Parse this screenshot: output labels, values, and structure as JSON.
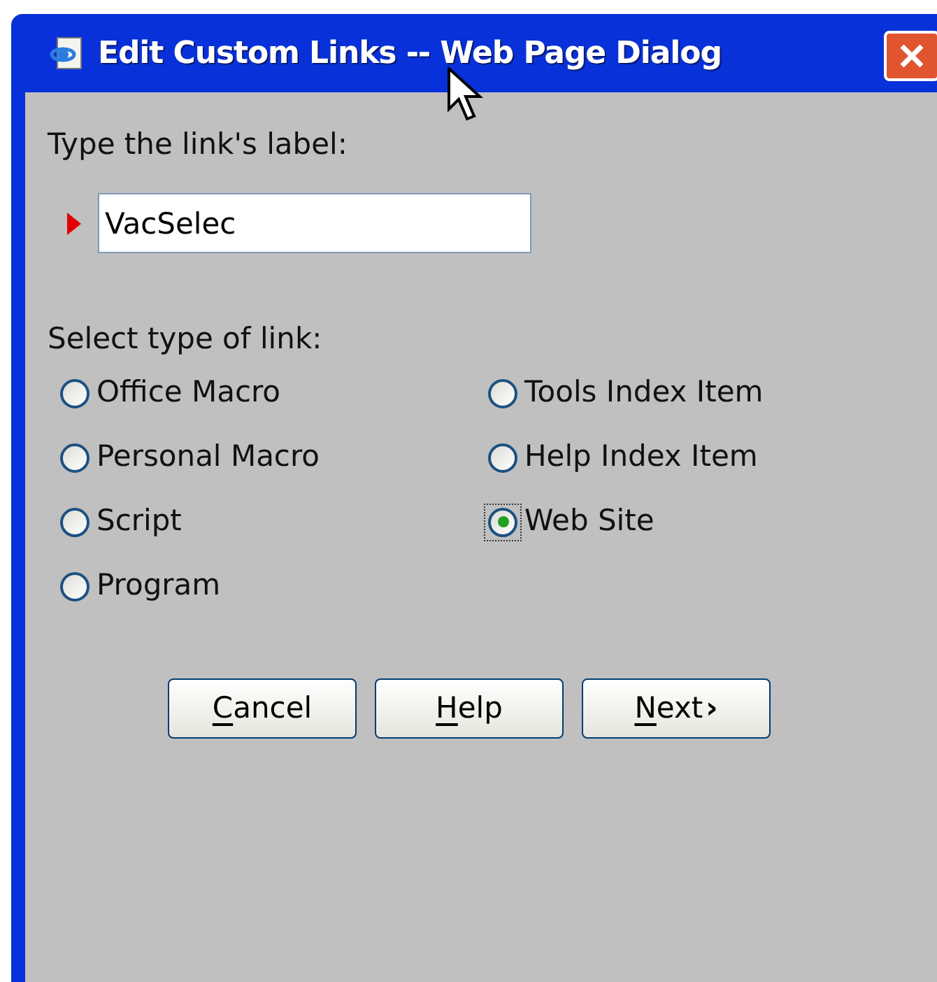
{
  "window": {
    "title": "Edit Custom Links -- Web Page Dialog"
  },
  "label_field": {
    "label": "Type the link's label:",
    "value": "VacSelec"
  },
  "link_type": {
    "label": "Select type of link:",
    "options": [
      {
        "label": "Office Macro",
        "selected": false,
        "focused": false
      },
      {
        "label": "Tools Index Item",
        "selected": false,
        "focused": false
      },
      {
        "label": "Personal Macro",
        "selected": false,
        "focused": false
      },
      {
        "label": "Help Index Item",
        "selected": false,
        "focused": false
      },
      {
        "label": "Script",
        "selected": false,
        "focused": false
      },
      {
        "label": "Web Site",
        "selected": true,
        "focused": true
      },
      {
        "label": "Program",
        "selected": false,
        "focused": false
      }
    ]
  },
  "buttons": [
    {
      "mnemonic": "C",
      "rest": "ancel"
    },
    {
      "mnemonic": "H",
      "rest": "elp"
    },
    {
      "mnemonic": "N",
      "rest": "ext",
      "suffix": "›"
    }
  ]
}
